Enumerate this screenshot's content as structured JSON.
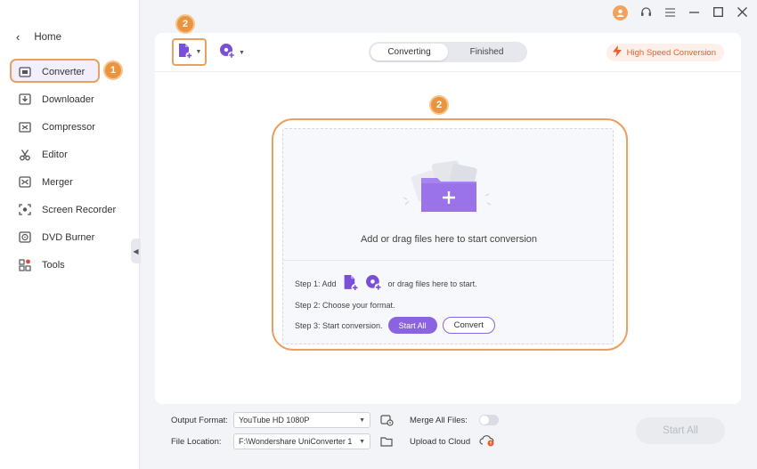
{
  "sidebar": {
    "home_label": "Home",
    "items": [
      {
        "label": "Converter",
        "icon": "converter-icon",
        "active": true
      },
      {
        "label": "Downloader",
        "icon": "downloader-icon"
      },
      {
        "label": "Compressor",
        "icon": "compressor-icon"
      },
      {
        "label": "Editor",
        "icon": "scissors-icon"
      },
      {
        "label": "Merger",
        "icon": "merger-icon"
      },
      {
        "label": "Screen Recorder",
        "icon": "screen-recorder-icon"
      },
      {
        "label": "DVD Burner",
        "icon": "dvd-icon"
      },
      {
        "label": "Tools",
        "icon": "tools-icon",
        "notification": true
      }
    ],
    "collapse_glyph": "◀"
  },
  "callouts": {
    "sidebar": "1",
    "add_file": "2",
    "drop_zone": "2"
  },
  "toolbar": {
    "tabs": [
      {
        "label": "Converting",
        "active": true
      },
      {
        "label": "Finished",
        "active": false
      }
    ],
    "high_speed_label": "High Speed Conversion"
  },
  "dropzone": {
    "prompt": "Add or drag files here to start conversion",
    "step1_prefix": "Step 1: Add",
    "step1_suffix": "or drag files here to start.",
    "step2": "Step 2: Choose your format.",
    "step3": "Step 3: Start conversion.",
    "start_all_label": "Start All",
    "convert_label": "Convert"
  },
  "bottom": {
    "output_format_label": "Output Format:",
    "output_format_value": "YouTube HD 1080P",
    "file_location_label": "File Location:",
    "file_location_value": "F:\\Wondershare UniConverter 1",
    "merge_label": "Merge All Files:",
    "merge_enabled": false,
    "upload_label": "Upload to Cloud",
    "start_all_label": "Start All"
  },
  "colors": {
    "accent_purple": "#8a63e0",
    "callout_orange": "#e9953f",
    "high_speed_orange": "#e8612c"
  }
}
